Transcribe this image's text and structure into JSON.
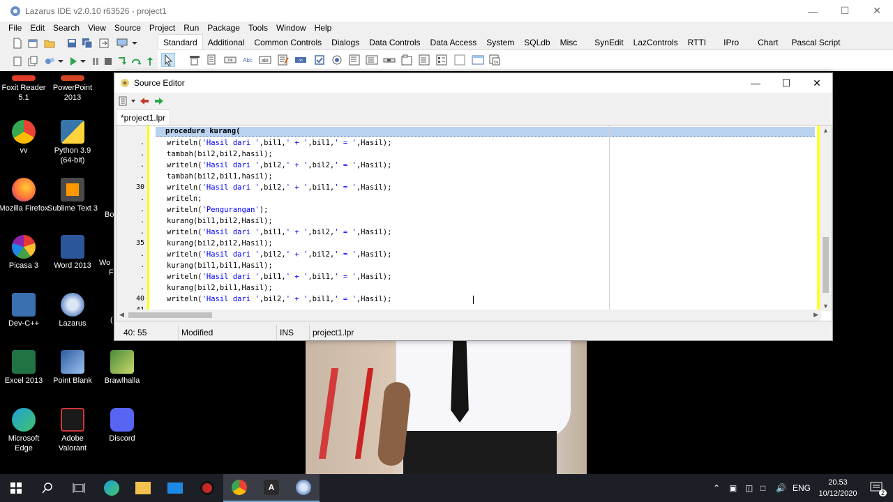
{
  "ide": {
    "title": "Lazarus IDE v2.0.10 r63526 - project1",
    "menu": [
      "File",
      "Edit",
      "Search",
      "View",
      "Source",
      "Project",
      "Run",
      "Package",
      "Tools",
      "Window",
      "Help"
    ],
    "palette_tabs": [
      "Standard",
      "Additional",
      "Common Controls",
      "Dialogs",
      "Data Controls",
      "Data Access",
      "System",
      "SQLdb",
      "Misc",
      "SynEdit",
      "LazControls",
      "RTTI",
      "IPro",
      "Chart",
      "Pascal Script"
    ],
    "active_palette_tab": "Standard"
  },
  "editor": {
    "title": "Source Editor",
    "tab_label": "*project1.lpr",
    "highlighted_line": "procedure kurang(",
    "lines": [
      {
        "num": "",
        "marker": ".",
        "text": "writeln('Hasil dari ',bil1,' + ',bil1,' = ',Hasil);"
      },
      {
        "num": "",
        "marker": ".",
        "text": "tambah(bil2,bil2,hasil);"
      },
      {
        "num": "",
        "marker": ".",
        "text": "writeln('Hasil dari ',bil2,' + ',bil2,' = ',Hasil);"
      },
      {
        "num": "",
        "marker": ".",
        "text": "tambah(bil2,bil1,hasil);"
      },
      {
        "num": "30",
        "marker": "",
        "text": "writeln('Hasil dari ',bil2,' + ',bil1,' = ',Hasil);"
      },
      {
        "num": "",
        "marker": ".",
        "text": "writeln;"
      },
      {
        "num": "",
        "marker": ".",
        "text": "writeln('Pengurangan');"
      },
      {
        "num": "",
        "marker": ".",
        "text": "kurang(bil1,bil2,Hasil);"
      },
      {
        "num": "",
        "marker": ".",
        "text": "writeln('Hasil dari ',bil1,' + ',bil2,' = ',Hasil);"
      },
      {
        "num": "35",
        "marker": "",
        "text": "kurang(bil2,bil2,Hasil);"
      },
      {
        "num": "",
        "marker": ".",
        "text": "writeln('Hasil dari ',bil2,' + ',bil2,' = ',Hasil);"
      },
      {
        "num": "",
        "marker": ".",
        "text": "kurang(bil1,bil1,Hasil);"
      },
      {
        "num": "",
        "marker": ".",
        "text": "writeln('Hasil dari ',bil1,' + ',bil1,' = ',Hasil);"
      },
      {
        "num": "",
        "marker": ".",
        "text": "kurang(bil2,bil1,Hasil);"
      },
      {
        "num": "40",
        "marker": "",
        "text": "writeln('Hasil dari ',bil2,' + ',bil1,' = ',Hasil);"
      },
      {
        "num": "41",
        "marker": "",
        "text": ""
      }
    ],
    "status": {
      "position": "40: 55",
      "modified": "Modified",
      "mode": "INS",
      "file": "project1.lpr"
    }
  },
  "desktop_icons": [
    {
      "label": "Foxit Reader 5.1",
      "icon": "foxit-icon",
      "color": "#e23b2a"
    },
    {
      "label": "PowerPoint 2013",
      "icon": "powerpoint-icon",
      "color": "#d04423"
    },
    {
      "label": "vv",
      "icon": "chrome-icon",
      "color": "#4285f4"
    },
    {
      "label": "Python 3.9 (64-bit)",
      "icon": "python-icon",
      "color": "#3776ab"
    },
    {
      "label": "Mozilla Firefox",
      "icon": "firefox-icon",
      "color": "#ff7139"
    },
    {
      "label": "Sublime Text 3",
      "icon": "sublime-icon",
      "color": "#ff9800"
    },
    {
      "label": "Picasa 3",
      "icon": "picasa-icon",
      "color": "#c2185b"
    },
    {
      "label": "Word 2013",
      "icon": "word-icon",
      "color": "#2b579a"
    },
    {
      "label": "Dev-C++",
      "icon": "devcpp-icon",
      "color": "#3a6fb0"
    },
    {
      "label": "Lazarus",
      "icon": "lazarus-icon",
      "color": "#6b8fc9"
    },
    {
      "label": "Excel 2013",
      "icon": "excel-icon",
      "color": "#217346"
    },
    {
      "label": "Point Blank",
      "icon": "pointblank-icon",
      "color": "#4a79c2"
    },
    {
      "label": "Brawlhalla",
      "icon": "brawlhalla-icon",
      "color": "#4b8a3a"
    },
    {
      "label": "Microsoft Edge",
      "icon": "edge-icon",
      "color": "#1fa0d8"
    },
    {
      "label": "Adobe Valorant",
      "icon": "valorant-icon",
      "color": "#d13639"
    },
    {
      "label": "Discord",
      "icon": "discord-icon",
      "color": "#5865f2"
    }
  ],
  "partial_desktop_labels": [
    "Bo",
    "Wo",
    "F",
    "("
  ],
  "taskbar": {
    "language": "ENG",
    "time": "20.53",
    "date": "10/12/2020",
    "notification_count": "2"
  }
}
